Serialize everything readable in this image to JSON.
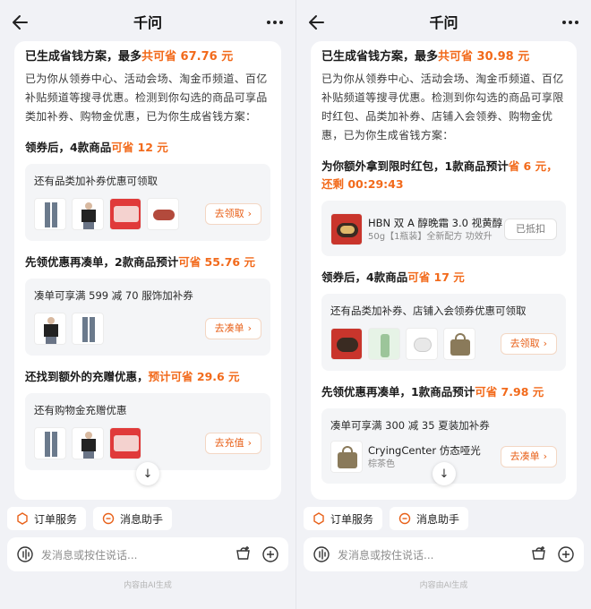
{
  "left": {
    "title": "千问",
    "headline": {
      "pre": "已生成省钱方案，最多",
      "hl": "共可省 67.76 元"
    },
    "intro": "已为你从领券中心、活动会场、淘金币频道、百亿补贴频道等搜寻优惠。检测到你勾选的商品可享品类加补券、购物金优惠，已为你生成省钱方案：",
    "sections": [
      {
        "title_pre": "领券后，4款商品",
        "title_hl": "可省 12 元",
        "card_title": "还有品类加补券优惠可领取",
        "button": "去领取"
      },
      {
        "title_pre": "先领优惠再凑单，2款商品预计",
        "title_hl": "可省 55.76 元",
        "card_title": "凑单可享满 599 减 70 服饰加补券",
        "button": "去凑单"
      },
      {
        "title_pre": "还找到额外的充赠优惠，",
        "title_hl": "预计可省 29.6 元",
        "card_title": "还有购物金充赠优惠",
        "button": "去充值"
      }
    ],
    "chips": [
      "订单服务",
      "消息助手"
    ],
    "input_placeholder": "发消息或按住说话...",
    "footer": "内容由AI生成"
  },
  "right": {
    "title": "千问",
    "headline": {
      "pre": "已生成省钱方案，最多",
      "hl": "共可省 30.98 元"
    },
    "intro": "已为你从领券中心、活动会场、淘金币频道、百亿补贴频道等搜寻优惠。检测到你勾选的商品可享限时红包、品类加补券、店铺入会领券、购物金优惠，已为你生成省钱方案：",
    "redpack": {
      "title_pre": "为你额外拿到限时红包，1款商品预计",
      "title_hl": "省 6 元，还剩 00:29:43",
      "product_name": "HBN 双 A 醇晚霜 3.0 视黄醇",
      "product_sub": "50g【1瓶装】全新配方 功效升",
      "button": "已抵扣"
    },
    "sections": [
      {
        "title_pre": "领券后，4款商品",
        "title_hl": "可省 17 元",
        "card_title": "还有品类加补券、店铺入会领券优惠可领取",
        "button": "去领取"
      },
      {
        "title_pre": "先领优惠再凑单，1款商品预计",
        "title_hl": "可省 7.98 元",
        "card_title": "凑单可享满 300 减 35 夏装加补券",
        "product_name": "CryingCenter 仿态哑光",
        "product_sub": "棕茶色",
        "button": "去凑单"
      }
    ],
    "chips": [
      "订单服务",
      "消息助手"
    ],
    "input_placeholder": "发消息或按住说话...",
    "footer": "内容由AI生成"
  },
  "colors": {
    "accent": "#f26a1b",
    "bg": "#f1f2f6",
    "card": "#f4f5f7"
  },
  "icons": [
    "back-arrow-icon",
    "more-icon",
    "scroll-down-icon",
    "order-service-icon",
    "message-assistant-icon",
    "voice-icon",
    "cart-plus-icon",
    "add-icon"
  ]
}
